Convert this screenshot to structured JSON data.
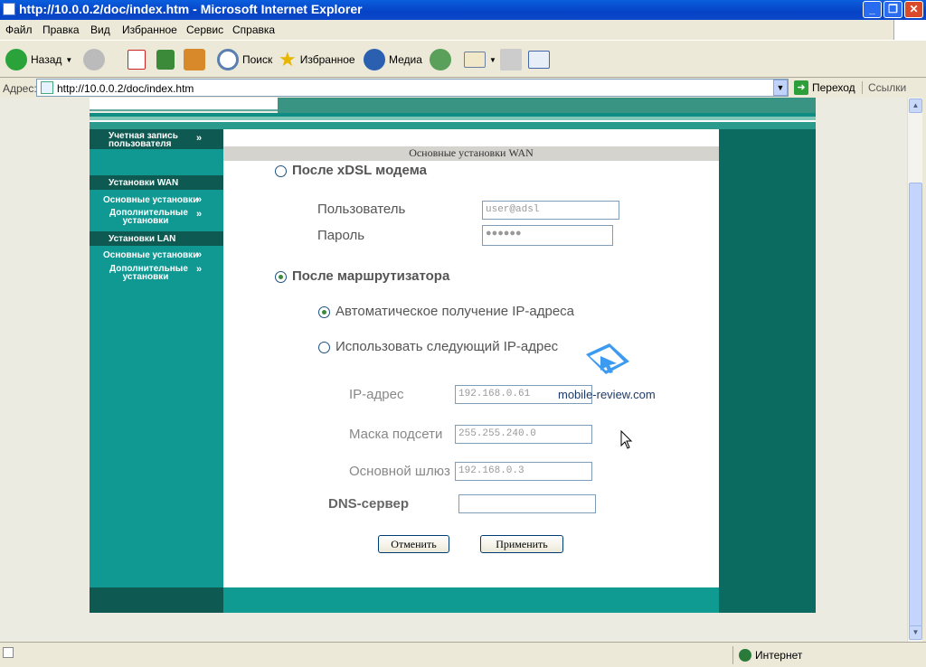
{
  "window": {
    "title": "http://10.0.0.2/doc/index.htm - Microsoft Internet Explorer"
  },
  "menu": [
    "Файл",
    "Правка",
    "Вид",
    "Избранное",
    "Сервис",
    "Справка"
  ],
  "toolbar": {
    "back": "Назад",
    "search": "Поиск",
    "favorites": "Избранное",
    "media": "Медиа"
  },
  "address": {
    "label": "Адрес:",
    "url": "http://10.0.0.2/doc/index.htm",
    "go": "Переход",
    "links": "Ссылки"
  },
  "status": {
    "zone": "Интернет"
  },
  "sidebar": {
    "account": "Учетная запись пользователя",
    "wan_header": "Установки WAN",
    "wan_basic": "Основные установки",
    "wan_advanced": "Дополнительные установки",
    "lan_header": "Установки LAN",
    "lan_basic": "Основные установки",
    "lan_advanced": "Дополнительные установки"
  },
  "form": {
    "header": "Основные установки WAN",
    "xdsl_option": "После xDSL модема",
    "user_label": "Пользователь",
    "user_value": "user@adsl",
    "password_label": "Пароль",
    "password_value": "●●●●●●",
    "router_option": "После маршрутизатора",
    "auto_ip_option": "Автоматическое получение IP-адреса",
    "manual_ip_option": "Использовать следующий IP-адрес",
    "ip_label": "IP-адрес",
    "ip_value": "192.168.0.61",
    "mask_label": "Маска подсети",
    "mask_value": "255.255.240.0",
    "gateway_label": "Основной шлюз",
    "gateway_value": "192.168.0.3",
    "dns_label": "DNS-сервер",
    "dns_value": "",
    "cancel": "Отменить",
    "apply": "Применить",
    "selected_mode": "router",
    "selected_ip_mode": "auto"
  },
  "watermark": {
    "text": "mobile-review.com"
  },
  "colors": {
    "teal": "#109993",
    "dark_teal": "#0e5a52",
    "right_col": "#0c6b60",
    "xp_blue": "#0a5fde"
  }
}
